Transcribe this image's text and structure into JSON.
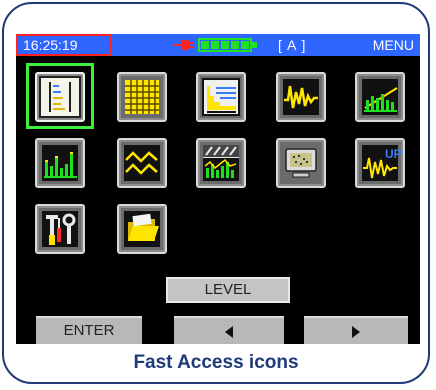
{
  "statusbar": {
    "time": "16:25:19",
    "mode": "[ A ]",
    "menu": "MENU",
    "plug_icon": "power-plug-icon",
    "battery_icon": "battery-full-icon",
    "battery_level": 1.0
  },
  "icons": [
    {
      "name": "vertical-scale-icon",
      "selected": true
    },
    {
      "name": "grid-icon"
    },
    {
      "name": "spectrum-table-icon"
    },
    {
      "name": "waveform-icon"
    },
    {
      "name": "rising-bars-icon"
    },
    {
      "name": "bar-spectrum-icon"
    },
    {
      "name": "zigzag-wave-icon"
    },
    {
      "name": "spectrum-compare-icon"
    },
    {
      "name": "monitor-icon"
    },
    {
      "name": "waveform-up-icon",
      "label": "UP"
    },
    {
      "name": "tools-icon"
    },
    {
      "name": "folder-icon"
    }
  ],
  "level_button": "LEVEL",
  "softkeys": {
    "enter": "ENTER",
    "left_icon": "left-arrow-icon",
    "right_icon": "right-arrow-icon"
  },
  "caption": "Fast Access icons",
  "colors": {
    "frame": "#1f3a78",
    "statusbar": "#2f66ff",
    "selection": "#3cf03c",
    "icon_yellow": "#ffe600",
    "icon_green": "#1ee01e"
  }
}
